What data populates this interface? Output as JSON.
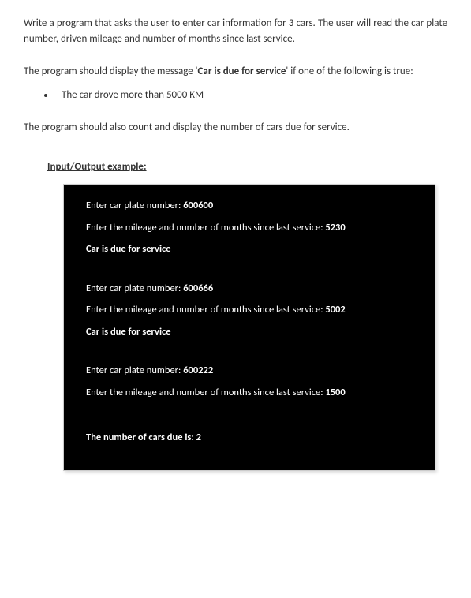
{
  "intro": "Write a program that asks the user to enter car information for 3 cars. The user will read the car plate number, driven mileage and number of months since last service.",
  "condition_prefix": "The program should display the message '",
  "condition_bold": "Car is due for service",
  "condition_suffix": "' if one of the following is true:",
  "bullet": "The car drove more than 5000 KM",
  "count_text": "The program should also count and display the number of cars due for service.",
  "example_heading": "Input/Output example:",
  "console": {
    "plate_prompt": "Enter car plate number: ",
    "mileage_prompt": "Enter the mileage and number of months since last service: ",
    "due_msg": "Car is due for service",
    "result_label": "The number of cars due is: ",
    "entries": [
      {
        "plate": "600600",
        "mileage": "5230",
        "due": true
      },
      {
        "plate": "600666",
        "mileage": "5002",
        "due": true
      },
      {
        "plate": "600222",
        "mileage": "1500",
        "due": false
      }
    ],
    "result_count": "2"
  }
}
